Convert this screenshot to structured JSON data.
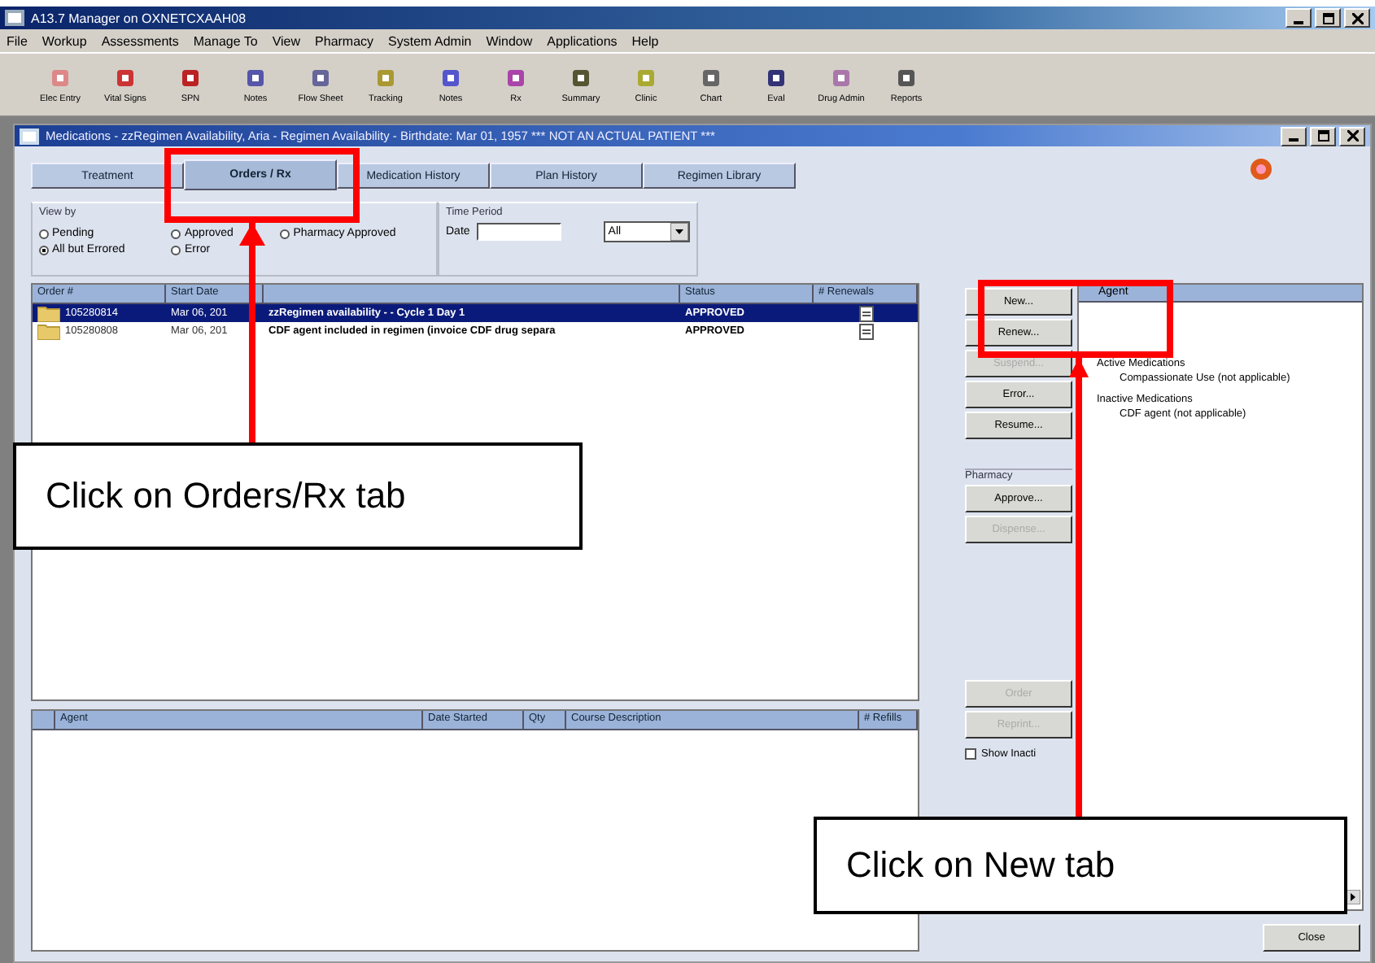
{
  "app_window": {
    "title": "A13.7 Manager on OXNETCXAAH08"
  },
  "menu": [
    "File",
    "Workup",
    "Assessments",
    "Manage To",
    "View",
    "Pharmacy",
    "System Admin",
    "Window",
    "Applications",
    "Help"
  ],
  "toolbar": [
    "Elec Entry",
    "Vital Signs",
    "SPN",
    "Notes",
    "Flow Sheet",
    "Tracking",
    "Notes",
    "Rx",
    "Summary",
    "Clinic",
    "Chart",
    "Eval",
    "Drug Admin",
    "Reports"
  ],
  "child_window": {
    "title": "Medications - zzRegimen Availability, Aria - Regimen Availability - Birthdate: Mar 01, 1957 *** NOT AN ACTUAL PATIENT ***"
  },
  "tabs": [
    {
      "label": "Treatment",
      "selected": false
    },
    {
      "label": "Orders / Rx",
      "selected": true
    },
    {
      "label": "Medication History",
      "selected": false
    },
    {
      "label": "Plan History",
      "selected": false
    },
    {
      "label": "Regimen Library",
      "selected": false
    }
  ],
  "view_by": {
    "label": "View by",
    "options": [
      {
        "label": "Pending",
        "selected": false
      },
      {
        "label": "Approved",
        "selected": false
      },
      {
        "label": "Pharmacy Approved",
        "selected": false
      },
      {
        "label": "All but Errored",
        "selected": true
      },
      {
        "label": "Error",
        "selected": false
      }
    ]
  },
  "time_period": {
    "label": "Time Period",
    "date_label": "Date",
    "range": "All"
  },
  "orders_table": {
    "columns": [
      "Order #",
      "Start Date",
      "",
      "Status",
      "# Renewals"
    ],
    "rows": [
      {
        "order": "105280814",
        "start_date": "Mar 06, 201",
        "description": "zzRegimen availability - - Cycle 1 Day 1",
        "status": "APPROVED",
        "selected": true
      },
      {
        "order": "105280808",
        "start_date": "Mar 06, 201",
        "description": "CDF agent included in regimen (invoice CDF drug separa",
        "status": "APPROVED",
        "selected": false
      }
    ]
  },
  "order_buttons": [
    {
      "label": "New...",
      "disabled": false
    },
    {
      "label": "Renew...",
      "disabled": false
    },
    {
      "label": "Suspend...",
      "disabled": true
    },
    {
      "label": "Error...",
      "disabled": false
    },
    {
      "label": "Resume...",
      "disabled": false
    }
  ],
  "pharmacy": {
    "label": "Pharmacy",
    "buttons": [
      {
        "label": "Approve...",
        "disabled": false
      },
      {
        "label": "Dispense...",
        "disabled": true
      }
    ]
  },
  "detail_buttons": [
    {
      "label": "Order",
      "disabled": true
    },
    {
      "label": "Reprint...",
      "disabled": true
    }
  ],
  "show_inactive": {
    "label": "Show Inacti",
    "checked": false
  },
  "agent_panel": {
    "header": "Agent",
    "groups": [
      {
        "label": "Active Medications",
        "children": [
          {
            "label": "Compassionate Use (not applicable)"
          }
        ]
      },
      {
        "label": "Inactive Medications",
        "children": [
          {
            "label": "CDF agent (not applicable)"
          }
        ]
      }
    ]
  },
  "detail_table": {
    "columns": [
      "Agent",
      "Date Started",
      "Qty",
      "Course Description",
      "# Refills"
    ]
  },
  "close_button": "Close",
  "callouts": [
    {
      "text": "Click on Orders/Rx tab"
    },
    {
      "text": "Click on New tab"
    }
  ]
}
